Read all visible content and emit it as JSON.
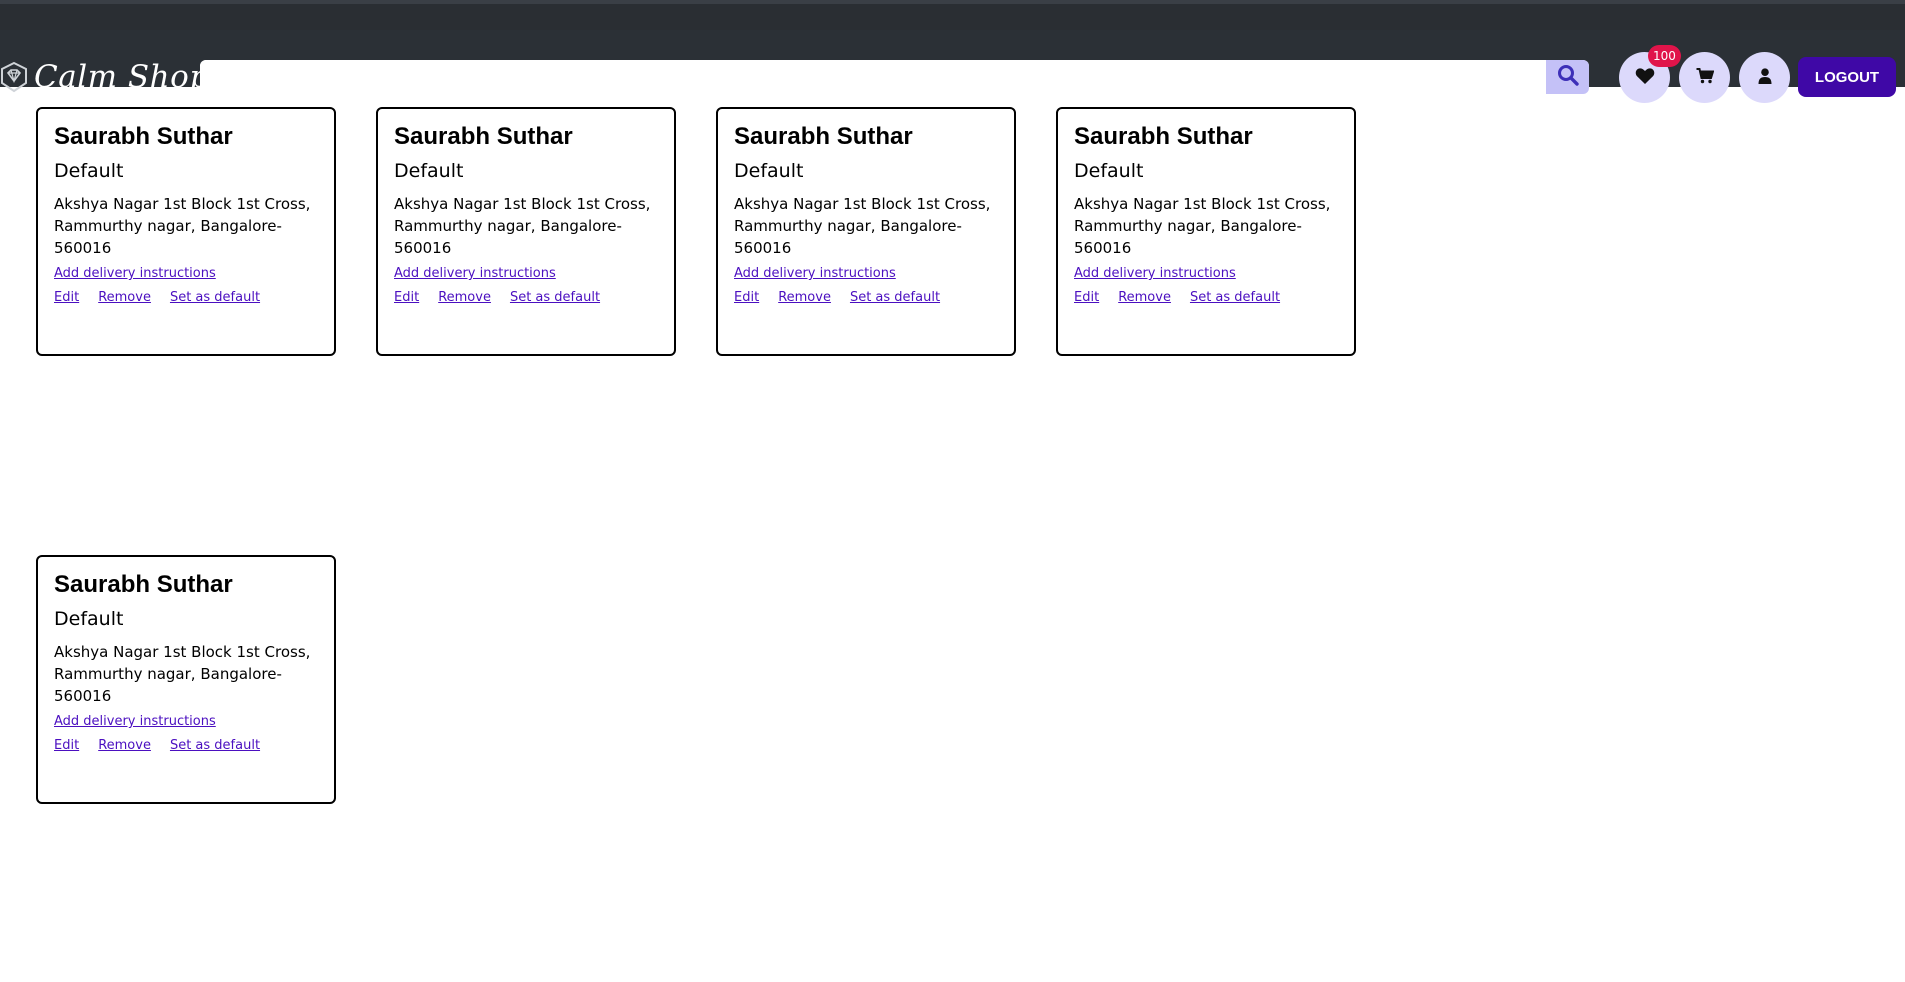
{
  "header": {
    "brand": "Calm Shop",
    "search": {
      "value": "",
      "placeholder": ""
    },
    "wishlist_count": "100",
    "logout_label": "LOGOUT",
    "icons": {
      "logo": "shield-diamond-icon",
      "search": "search-icon",
      "wishlist": "heart-icon",
      "cart": "cart-icon",
      "account": "user-icon"
    }
  },
  "addresses": [
    {
      "name": "Saurabh Suthar",
      "label": "Default",
      "address": "Akshya Nagar 1st Block 1st Cross, Rammurthy nagar, Bangalore-560016",
      "instructions": "Add delivery instructions",
      "edit": "Edit",
      "remove": "Remove",
      "set_default": "Set as default"
    },
    {
      "name": "Saurabh Suthar",
      "label": "Default",
      "address": "Akshya Nagar 1st Block 1st Cross, Rammurthy nagar, Bangalore-560016",
      "instructions": "Add delivery instructions",
      "edit": "Edit",
      "remove": "Remove",
      "set_default": "Set as default"
    },
    {
      "name": "Saurabh Suthar",
      "label": "Default",
      "address": "Akshya Nagar 1st Block 1st Cross, Rammurthy nagar, Bangalore-560016",
      "instructions": "Add delivery instructions",
      "edit": "Edit",
      "remove": "Remove",
      "set_default": "Set as default"
    },
    {
      "name": "Saurabh Suthar",
      "label": "Default",
      "address": "Akshya Nagar 1st Block 1st Cross, Rammurthy nagar, Bangalore-560016",
      "instructions": "Add delivery instructions",
      "edit": "Edit",
      "remove": "Remove",
      "set_default": "Set as default"
    },
    {
      "name": "Saurabh Suthar",
      "label": "Default",
      "address": "Akshya Nagar 1st Block 1st Cross, Rammurthy nagar, Bangalore-560016",
      "instructions": "Add delivery instructions",
      "edit": "Edit",
      "remove": "Remove",
      "set_default": "Set as default"
    }
  ],
  "colors": {
    "navbar": "#2b3036",
    "accent": "#3f08a6",
    "link": "#4b0fc0",
    "icon_bg": "#dcd9fb",
    "badge": "#e0144a"
  }
}
